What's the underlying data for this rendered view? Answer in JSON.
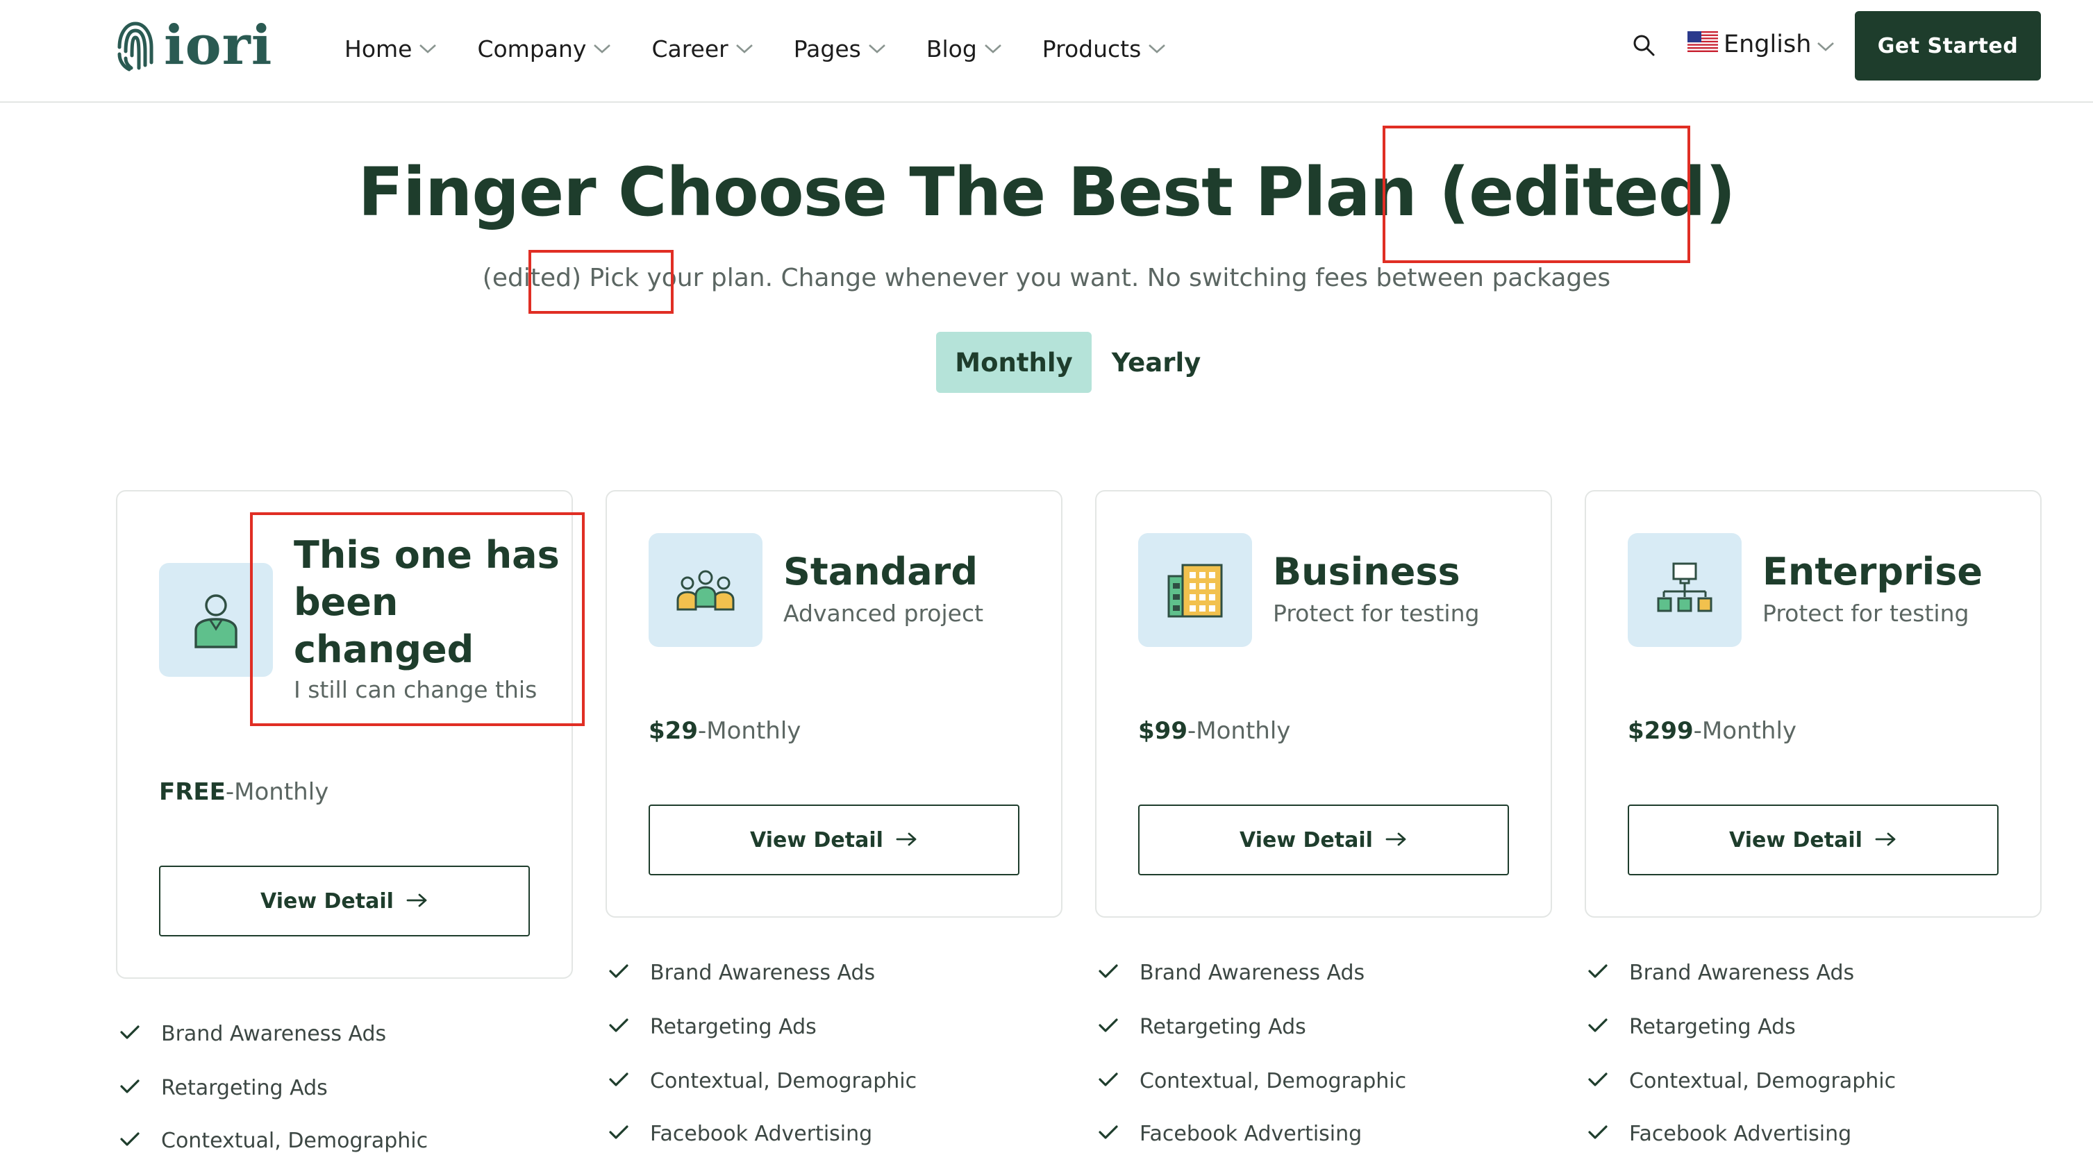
{
  "header": {
    "logo_text": "iori",
    "nav": [
      {
        "label": "Home"
      },
      {
        "label": "Company"
      },
      {
        "label": "Career"
      },
      {
        "label": "Pages"
      },
      {
        "label": "Blog"
      },
      {
        "label": "Products"
      }
    ],
    "language": "English",
    "cta_label": "Get Started"
  },
  "hero": {
    "title": "Finger Choose The Best Plan (edited)",
    "subtitle": "(edited) Pick your plan. Change whenever you want. No switching fees between packages"
  },
  "billing_toggle": {
    "options": [
      "Monthly",
      "Yearly"
    ],
    "selected": "Monthly"
  },
  "plans": [
    {
      "name": "This one has been changed",
      "description": "I still can change this",
      "price": "FREE",
      "period": "-Monthly",
      "button": "View Detail",
      "icon": "person-icon",
      "features": [
        "Brand Awareness Ads",
        "Retargeting Ads",
        "Contextual, Demographic"
      ]
    },
    {
      "name": "Standard",
      "description": "Advanced project",
      "price": "$29",
      "period": "-Monthly",
      "button": "View Detail",
      "icon": "team-icon",
      "features": [
        "Brand Awareness Ads",
        "Retargeting Ads",
        "Contextual, Demographic",
        "Facebook Advertising"
      ]
    },
    {
      "name": "Business",
      "description": "Protect for testing",
      "price": "$99",
      "period": "-Monthly",
      "button": "View Detail",
      "icon": "building-icon",
      "features": [
        "Brand Awareness Ads",
        "Retargeting Ads",
        "Contextual, Demographic",
        "Facebook Advertising"
      ]
    },
    {
      "name": "Enterprise",
      "description": "Protect for testing",
      "price": "$299",
      "period": "-Monthly",
      "button": "View Detail",
      "icon": "network-icon",
      "features": [
        "Brand Awareness Ads",
        "Retargeting Ads",
        "Contextual, Demographic",
        "Facebook Advertising"
      ]
    }
  ],
  "colors": {
    "brand_dark": "#1e3d2c",
    "toggle_active": "#b5e3d9",
    "icon_tile": "#d8ebf5",
    "annotation_red": "#e02e24"
  }
}
